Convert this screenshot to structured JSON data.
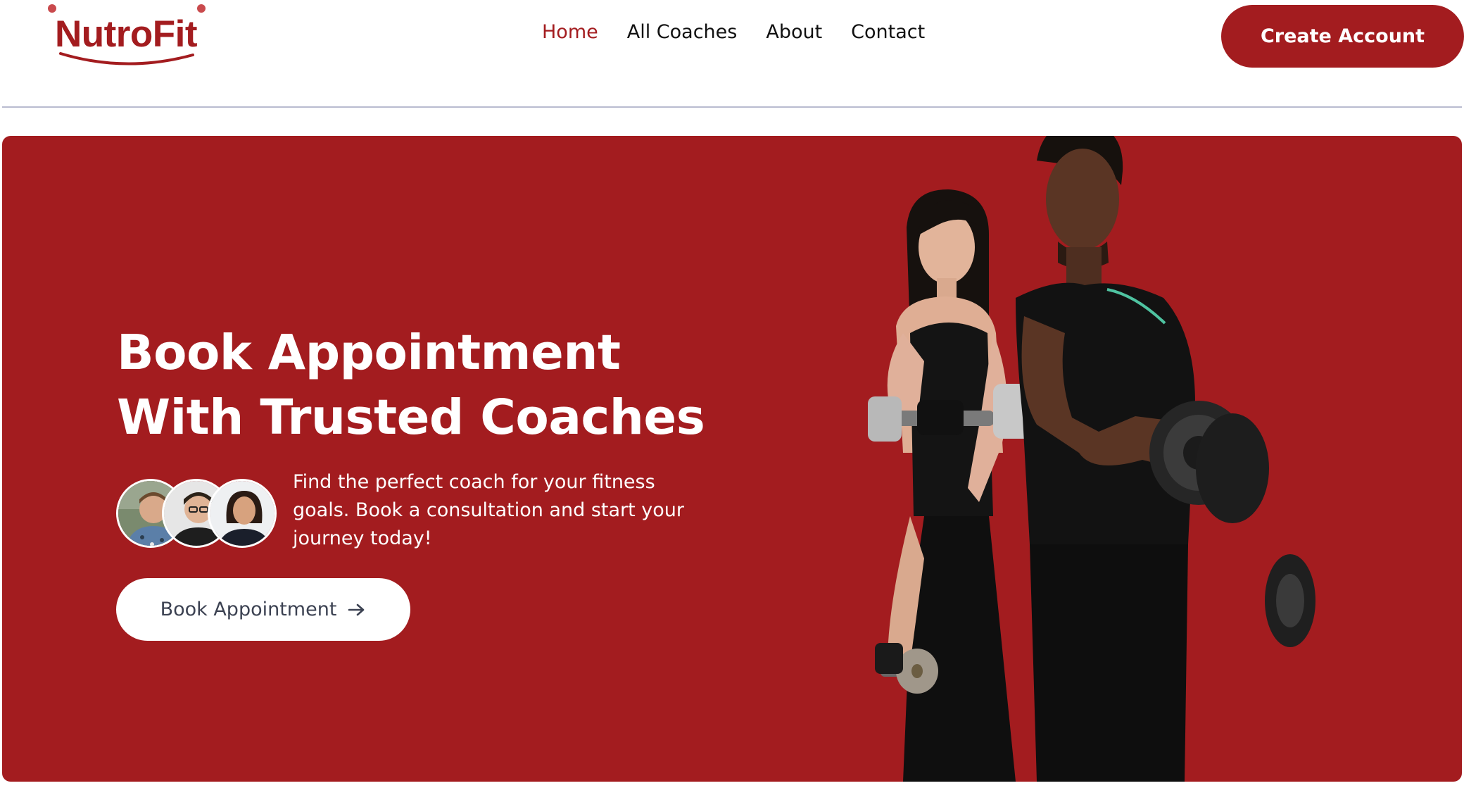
{
  "header": {
    "logo_text": "NutroFit",
    "nav": [
      {
        "label": "Home",
        "active": true
      },
      {
        "label": "All Coaches",
        "active": false
      },
      {
        "label": "About",
        "active": false
      },
      {
        "label": "Contact",
        "active": false
      }
    ],
    "cta_label": "Create Account"
  },
  "hero": {
    "title": "Book Appointment\nWith Trusted Coaches",
    "description": "Find the perfect coach for your fitness goals. Book a consultation and start your journey today!",
    "button_label": "Book Appointment",
    "button_icon": "arrow-right-icon",
    "avatars": [
      "coach-avatar-1",
      "coach-avatar-2",
      "coach-avatar-3"
    ]
  },
  "colors": {
    "brand": "#a31c1f",
    "text_dark": "#111111",
    "button_text": "#3c4252",
    "divider": "#b9bbd0"
  }
}
